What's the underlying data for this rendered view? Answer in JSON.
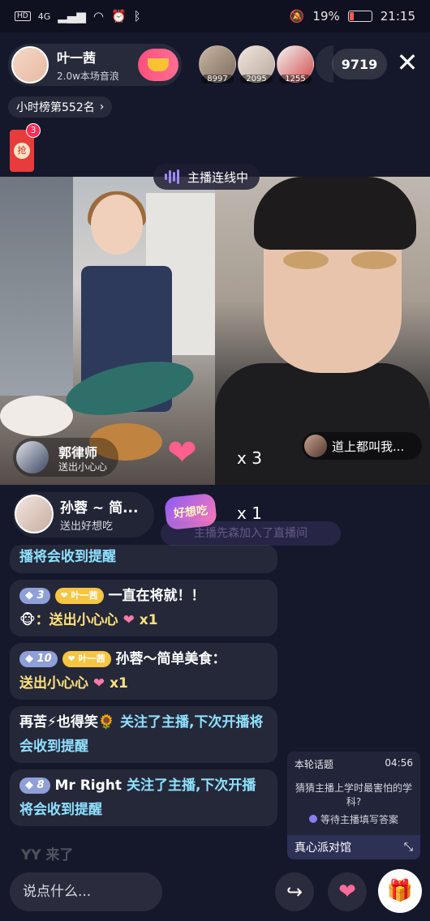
{
  "status_bar": {
    "hd": "HD",
    "signal": "4G",
    "battery_percent": "19%",
    "time": "21:15"
  },
  "host": {
    "name": "叶一茜",
    "subtitle": "2.0w本场音浪"
  },
  "viewers": [
    {
      "count": "8997"
    },
    {
      "count": "2095"
    },
    {
      "count": "1255"
    }
  ],
  "viewer_count": "9719",
  "close_label": "✕",
  "rank_label": "小时榜第552名",
  "red_packet": {
    "label": "抢",
    "badge": "3"
  },
  "linking_label": "主播连线中",
  "left_guest": {
    "name": "郭律师",
    "sub": "送出小心心"
  },
  "gift_combo_1": "x 3",
  "right_bubble": "道上都叫我...",
  "gift_notice": {
    "name": "孙蓉 ~ 简...",
    "sub": "送出好想吃",
    "gift_label": "好想吃",
    "count": "x 1"
  },
  "faded_banner": "主播先森加入了直播间",
  "chat": [
    {
      "text": "播将会收到提醒"
    },
    {
      "level": "3",
      "fan": "叶一茜",
      "user": "一直在将就！！",
      "emoji": "🐵",
      "action": "：送出小心心",
      "gift": "❤",
      "count": "x1"
    },
    {
      "level": "10",
      "fan": "叶一茜",
      "user": "孙蓉～简单美食：",
      "action": "送出小心心",
      "gift": "❤",
      "count": "x1"
    },
    {
      "user": "再苦⚡也得笑🌻",
      "action": "关注了主播,下次开播将会收到提醒"
    },
    {
      "level": "8",
      "user": "Mr Right",
      "action": "关注了主播,下次开播将会收到提醒"
    }
  ],
  "topic": {
    "title": "本轮话题",
    "timer": "04:56",
    "question": "猜猜主播上学时最害怕的学科?",
    "status": "等待主播填写答案",
    "footer": "真心派对馆"
  },
  "faded_message": "YY 来了",
  "bottom": {
    "input_placeholder": "说点什么..."
  }
}
